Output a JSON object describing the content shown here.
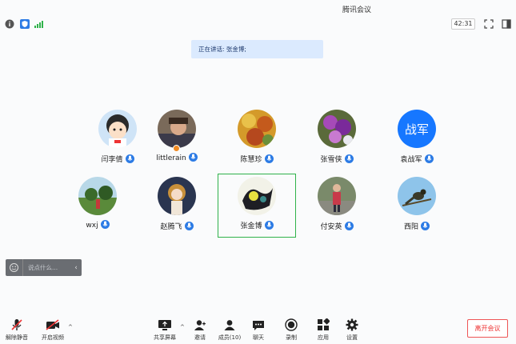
{
  "window": {
    "title": "腾讯会议"
  },
  "status": {
    "icons": [
      "info-icon",
      "shield-icon",
      "signal-icon"
    ],
    "timer": "42:31",
    "right_icons": [
      "fullscreen-icon",
      "sidebar-toggle-icon"
    ]
  },
  "banner": {
    "text": "正在讲话: 张金博;"
  },
  "participants": [
    {
      "name": "闫李倩",
      "avatar": "cartoon-girl"
    },
    {
      "name": "littlerain",
      "avatar": "child-photo"
    },
    {
      "name": "陈慧珍",
      "avatar": "flowers"
    },
    {
      "name": "张雪侠",
      "avatar": "purple-flowers"
    },
    {
      "name": "袁战军",
      "avatar": "text-avatar",
      "avatar_text": "战军"
    },
    {
      "name": "wxj",
      "avatar": "garden"
    },
    {
      "name": "赵腾飞",
      "avatar": "anime-girl"
    },
    {
      "name": "张金博",
      "avatar": "dark-art"
    },
    {
      "name": "付安英",
      "avatar": "person-outdoor"
    },
    {
      "name": "西阳",
      "avatar": "bird-sky"
    }
  ],
  "chat": {
    "placeholder": "说点什么..."
  },
  "toolbar": {
    "unmute": "解除静音",
    "start_video": "开启视频",
    "share_screen": "共享屏幕",
    "invite": "邀请",
    "members": "成员(10)",
    "chat": "聊天",
    "record": "录制",
    "apps": "应用",
    "settings": "设置",
    "leave": "离开会议"
  },
  "colors": {
    "accent": "#2c7be5",
    "active_border": "#2fb24a",
    "leave": "#e33333"
  }
}
